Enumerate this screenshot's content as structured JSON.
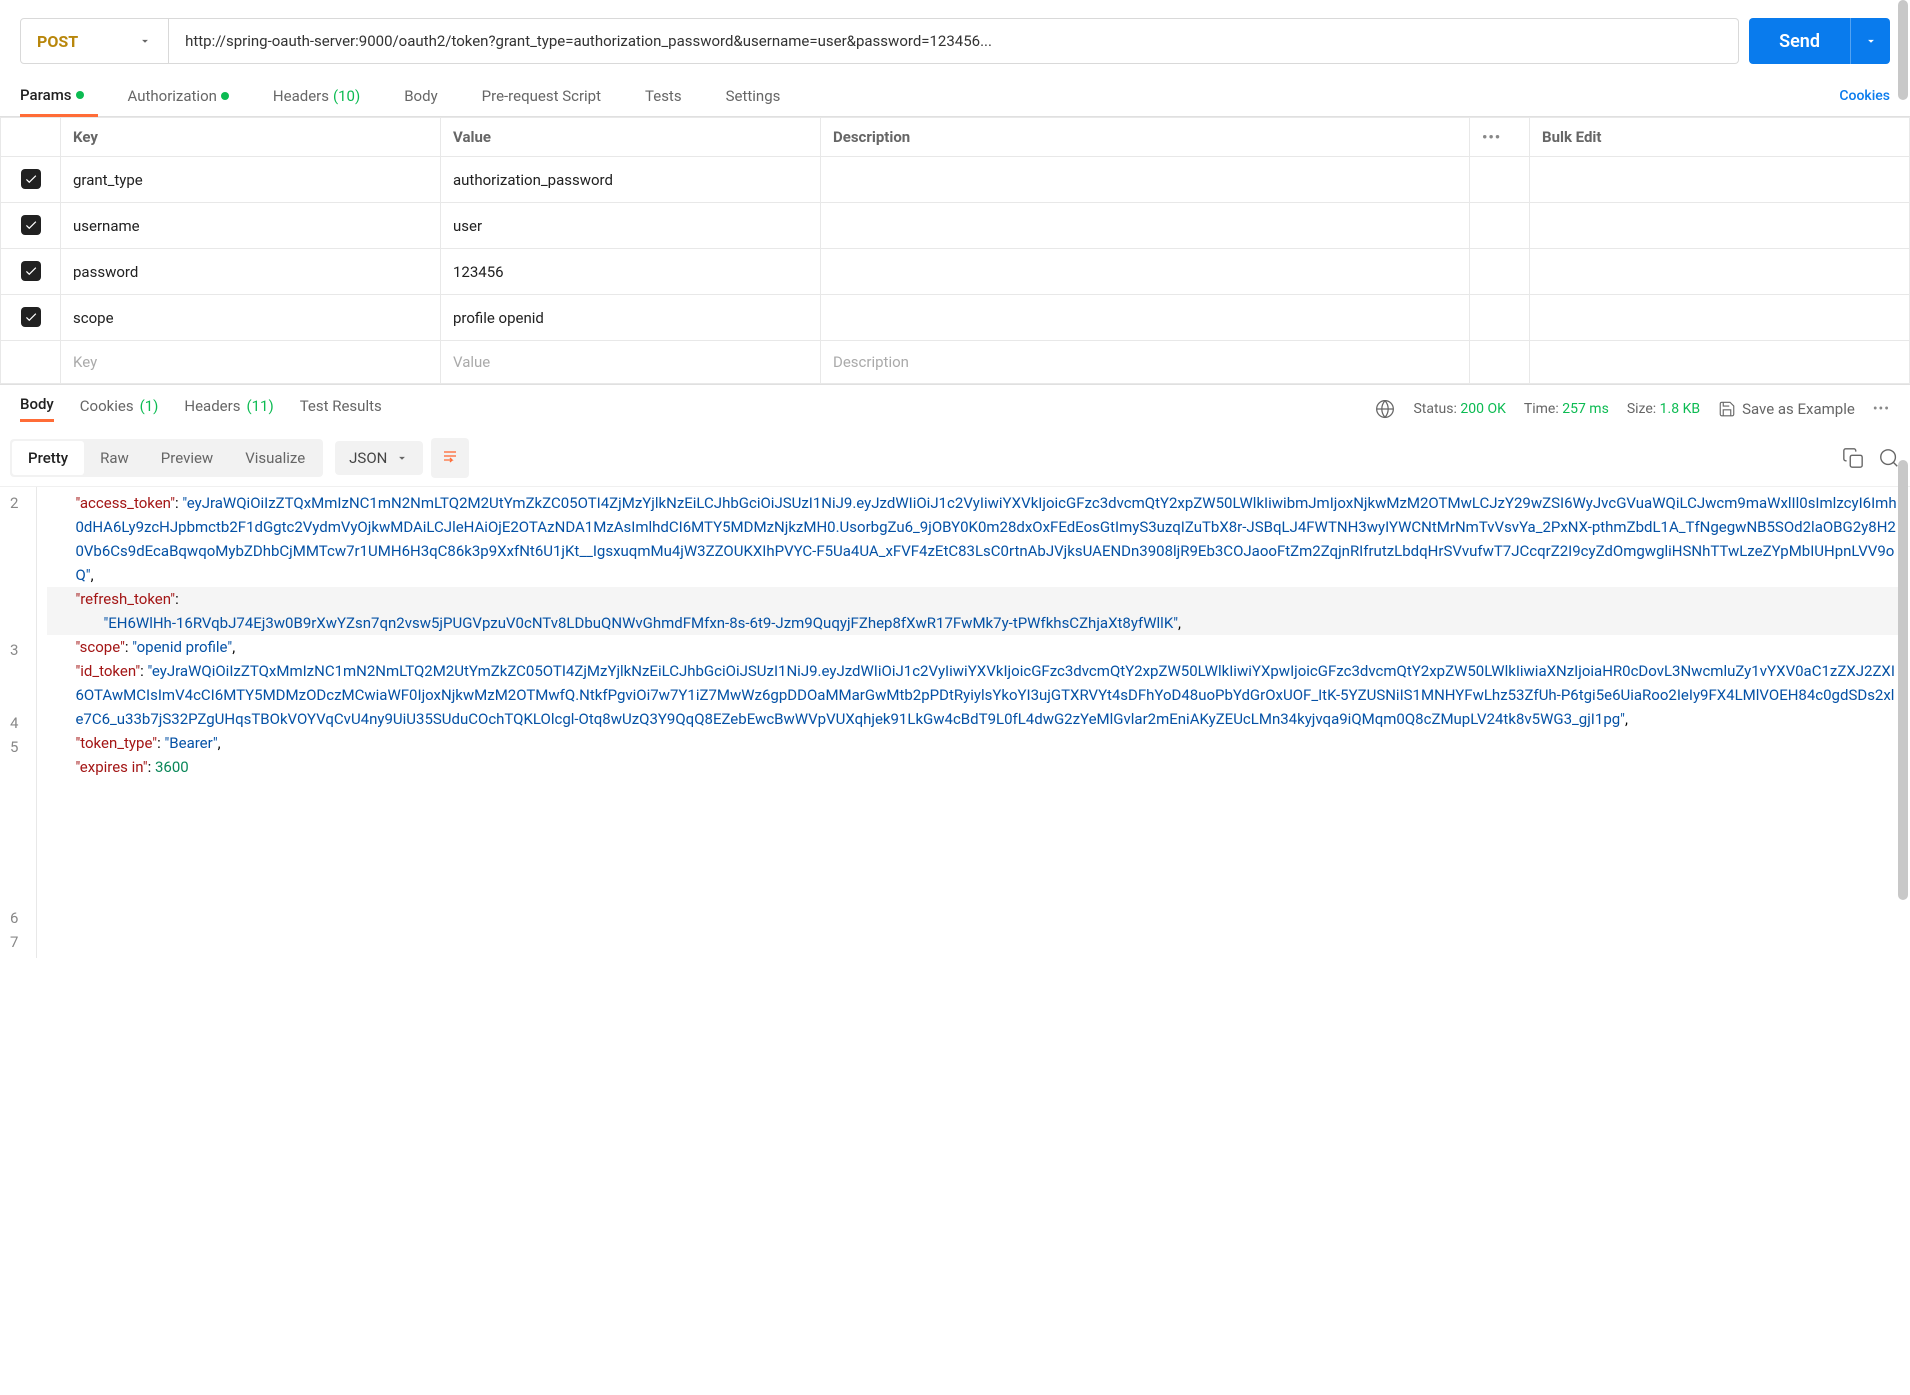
{
  "request": {
    "method": "POST",
    "url": "http://spring-oauth-server:9000/oauth2/token?grant_type=authorization_password&username=user&password=123456...",
    "send_label": "Send"
  },
  "req_tabs": {
    "params": "Params",
    "authorization": "Authorization",
    "headers": "Headers",
    "headers_count": "(10)",
    "body": "Body",
    "prerequest": "Pre-request Script",
    "tests": "Tests",
    "settings": "Settings",
    "cookies": "Cookies"
  },
  "params_headers": {
    "key": "Key",
    "value": "Value",
    "description": "Description",
    "bulk_edit": "Bulk Edit"
  },
  "params": [
    {
      "key": "grant_type",
      "value": "authorization_password",
      "checked": true
    },
    {
      "key": "username",
      "value": "user",
      "checked": true
    },
    {
      "key": "password",
      "value": "123456",
      "checked": true
    },
    {
      "key": "scope",
      "value": "profile openid",
      "checked": true
    }
  ],
  "params_placeholder": {
    "key": "Key",
    "value": "Value",
    "description": "Description"
  },
  "resp_tabs": {
    "body": "Body",
    "cookies": "Cookies",
    "cookies_count": "(1)",
    "headers": "Headers",
    "headers_count": "(11)",
    "test_results": "Test Results"
  },
  "resp_meta": {
    "status_label": "Status:",
    "status_value": "200 OK",
    "time_label": "Time:",
    "time_value": "257 ms",
    "size_label": "Size:",
    "size_value": "1.8 KB",
    "save_example": "Save as Example"
  },
  "view": {
    "pretty": "Pretty",
    "raw": "Raw",
    "preview": "Preview",
    "visualize": "Visualize",
    "format": "JSON"
  },
  "response_body": {
    "access_token_key": "\"access_token\"",
    "access_token_value": "\"eyJraWQiOiIzZTQxMmIzNC1mN2NmLTQ2M2UtYmZkZC05OTI4ZjMzYjlkNzEiLCJhbGciOiJSUzI1NiJ9.eyJzdWIiOiJ1c2VyIiwiYXVkIjoicGFzc3dvcmQtY2xpZW50LWlkIiwibmJmIjoxNjkwMzM2OTMwLCJzY29wZSI6WyJvcGVuaWQiLCJwcm9maWxlIl0sImlzcyI6Imh0dHA6Ly9zcHJpbmctb2F1dGgtc2VydmVyOjkwMDAiLCJleHAiOjE2OTAzNDA1MzAsImlhdCI6MTY5MDMzNjkzMH0.UsorbgZu6_9jOBY0K0m28dxOxFEdEosGtImyS3uzqIZuTbX8r-JSBqLJ4FWTNH3wyIYWCNtMrNmTvVsvYa_2PxNX-pthmZbdL1A_TfNgegwNB5SOd2laOBG2y8H20Vb6Cs9dEcaBqwqoMybZDhbCjMMTcw7r1UMH6H3qC86k3p9XxfNt6U1jKt__IgsxuqmMu4jW3ZZOUKXIhPVYC-F5Ua4UA_xFVF4zEtC83LsC0rtnAbJVjksUAENDn3908ljR9Eb3COJaooFtZm2ZqjnRIfrutzLbdqHrSVvufwT7JCcqrZ2I9cyZdOmgwgliHSNhTTwLzeZYpMbIUHpnLVV9oQ\"",
    "refresh_token_key": "\"refresh_token\"",
    "refresh_token_value": "\"EH6WlHh-16RVqbJ74Ej3w0B9rXwYZsn7qn2vsw5jPUGVpzuV0cNTv8LDbuQNWvGhmdFMfxn-8s-6t9-Jzm9QuqyjFZhep8fXwR17FwMk7y-tPWfkhsCZhjaXt8yfWllK\"",
    "scope_key": "\"scope\"",
    "scope_value": "\"openid profile\"",
    "id_token_key": "\"id_token\"",
    "id_token_value": "\"eyJraWQiOiIzZTQxMmIzNC1mN2NmLTQ2M2UtYmZkZC05OTI4ZjMzYjlkNzEiLCJhbGciOiJSUzI1NiJ9.eyJzdWIiOiJ1c2VyIiwiYXVkIjoicGFzc3dvcmQtY2xpZW50LWlkIiwiYXpwIjoicGFzc3dvcmQtY2xpZW50LWlkIiwiaXNzIjoiaHR0cDovL3NwcmluZy1vYXV0aC1zZXJ2ZXI6OTAwMCIsImV4cCI6MTY5MDMzODczMCwiaWF0IjoxNjkwMzM2OTMwfQ.NtkfPgviOi7w7Y1iZ7MwWz6gpDDOaMMarGwMtb2pPDtRyiylsYkoYI3ujGTXRVYt4sDFhYoD48uoPbYdGrOxUOF_ItK-5YZUSNiIS1MNHYFwLhz53ZfUh-P6tgi5e6UiaRoo2IeIy9FX4LMlVOEH84c0gdSDs2xle7C6_u33b7jS32PZgUHqsTBOkVOYVqCvU4ny9UiU35SUduCOchTQKLOlcgl-Otq8wUzQ3Y9QqQ8EZebEwcBwWVpVUXqhjek91LkGw4cBdT9L0fL4dwG2zYeMlGvlar2mEniAKyZEUcLMn34kyjvqa9iQMqm0Q8cZMupLV24tk8v5WG3_gjI1pg\"",
    "token_type_key": "\"token_type\"",
    "token_type_value": "\"Bearer\"",
    "expires_in_key": "\"expires in\"",
    "expires_in_value": "3600"
  }
}
